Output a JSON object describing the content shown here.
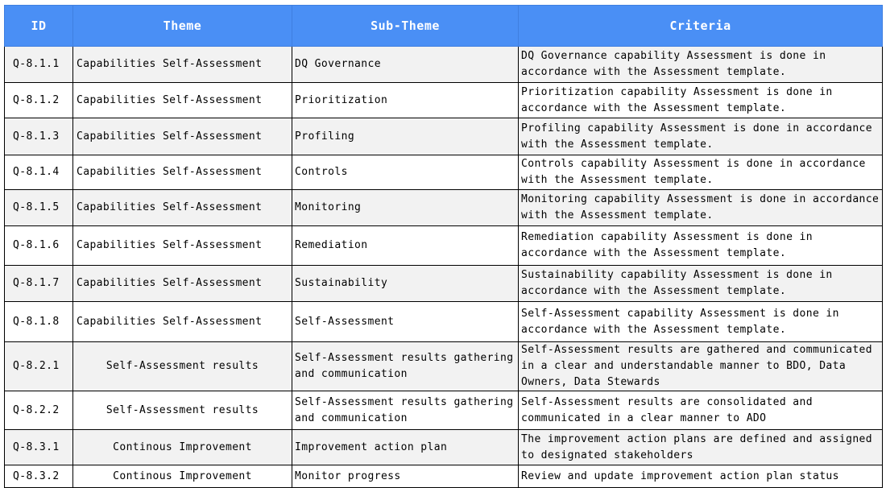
{
  "headers": {
    "id": "ID",
    "theme": "Theme",
    "sub_theme": "Sub-Theme",
    "criteria": "Criteria"
  },
  "rows": [
    {
      "id": "Q-8.1.1",
      "theme": "Capabilities Self-Assessment",
      "sub_theme": "DQ Governance",
      "criteria": "DQ Governance capability Assessment is done in accordance with the Assessment template."
    },
    {
      "id": "Q-8.1.2",
      "theme": "Capabilities Self-Assessment",
      "sub_theme": "Prioritization",
      "criteria": "Prioritization capability Assessment is done in accordance with the Assessment template."
    },
    {
      "id": "Q-8.1.3",
      "theme": "Capabilities Self-Assessment",
      "sub_theme": "Profiling",
      "criteria": "Profiling capability Assessment is done in accordance with the Assessment template."
    },
    {
      "id": "Q-8.1.4",
      "theme": "Capabilities Self-Assessment",
      "sub_theme": "Controls",
      "criteria": "Controls capability Assessment is done in accordance with the Assessment template."
    },
    {
      "id": "Q-8.1.5",
      "theme": "Capabilities Self-Assessment",
      "sub_theme": "Monitoring",
      "criteria": "Monitoring capability Assessment is done in accordance with the Assessment template."
    },
    {
      "id": "Q-8.1.6",
      "theme": "Capabilities Self-Assessment",
      "sub_theme": "Remediation",
      "criteria": "Remediation capability Assessment is done in accordance with the Assessment template."
    },
    {
      "id": "Q-8.1.7",
      "theme": "Capabilities Self-Assessment",
      "sub_theme": "Sustainability",
      "criteria": "Sustainability capability Assessment is done in accordance with the Assessment template."
    },
    {
      "id": "Q-8.1.8",
      "theme": "Capabilities Self-Assessment",
      "sub_theme": "Self-Assessment",
      "criteria": "Self-Assessment capability Assessment is done in accordance with the Assessment template."
    },
    {
      "id": "Q-8.2.1",
      "theme": "Self-Assessment results",
      "sub_theme": "Self-Assessment results gathering and communication",
      "criteria": "Self-Assessment results are gathered and communicated in a clear and understandable manner to BDO, Data Owners, Data Stewards"
    },
    {
      "id": "Q-8.2.2",
      "theme": "Self-Assessment results",
      "sub_theme": "Self-Assessment results gathering and communication",
      "criteria": "Self-Assessment results are consolidated and communicated in a clear manner to ADO"
    },
    {
      "id": "Q-8.3.1",
      "theme": "Continous Improvement",
      "sub_theme": "Improvement action plan",
      "criteria": "The improvement action plans are defined and assigned to designated stakeholders"
    },
    {
      "id": "Q-8.3.2",
      "theme": "Continous Improvement",
      "sub_theme": "Monitor progress",
      "criteria": "Review and update improvement action plan status"
    }
  ]
}
